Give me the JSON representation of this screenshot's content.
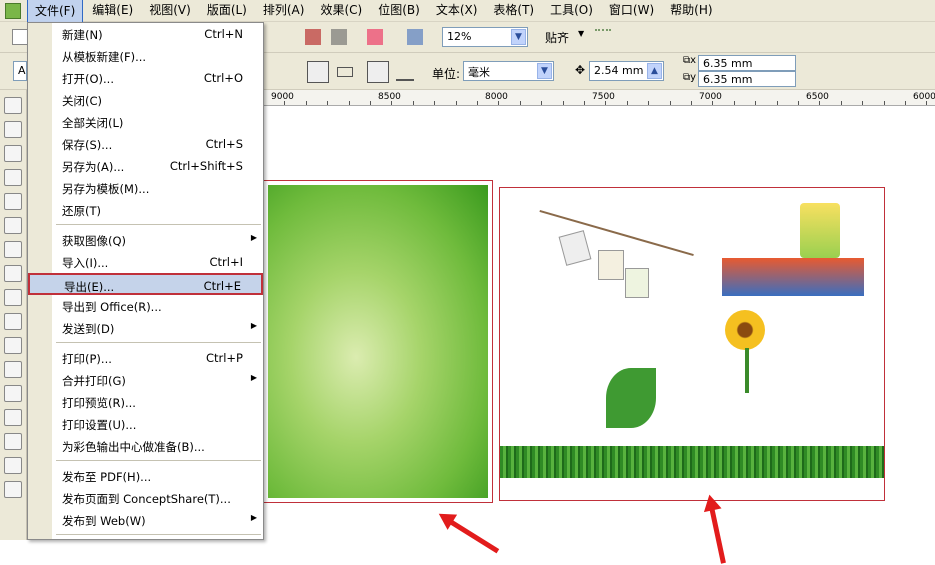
{
  "menubar": {
    "items": [
      "文件(F)",
      "编辑(E)",
      "视图(V)",
      "版面(L)",
      "排列(A)",
      "效果(C)",
      "位图(B)",
      "文本(X)",
      "表格(T)",
      "工具(O)",
      "窗口(W)",
      "帮助(H)"
    ]
  },
  "toolbar": {
    "zoom": "12%",
    "snap_label": "贴齐",
    "unit_label": "单位:",
    "unit_value": "毫米",
    "nudge": "2.54 mm",
    "dup_x": "6.35 mm",
    "dup_y": "6.35 mm",
    "font_partial": "A"
  },
  "ruler": {
    "labels": [
      "9000",
      "8500",
      "8000",
      "7500",
      "7000",
      "6500",
      "6000"
    ]
  },
  "file_menu": {
    "items": [
      {
        "label": "新建(N)",
        "shortcut": "Ctrl+N"
      },
      {
        "label": "从模板新建(F)...",
        "shortcut": ""
      },
      {
        "label": "打开(O)...",
        "shortcut": "Ctrl+O"
      },
      {
        "label": "关闭(C)",
        "shortcut": ""
      },
      {
        "label": "全部关闭(L)",
        "shortcut": ""
      },
      {
        "label": "保存(S)...",
        "shortcut": "Ctrl+S"
      },
      {
        "label": "另存为(A)...",
        "shortcut": "Ctrl+Shift+S"
      },
      {
        "label": "另存为模板(M)...",
        "shortcut": ""
      },
      {
        "label": "还原(T)",
        "shortcut": ""
      },
      {
        "label": "获取图像(Q)",
        "shortcut": "",
        "submenu": true
      },
      {
        "label": "导入(I)...",
        "shortcut": "Ctrl+I"
      },
      {
        "label": "导出(E)...",
        "shortcut": "Ctrl+E",
        "highlighted": true
      },
      {
        "label": "导出到 Office(R)...",
        "shortcut": ""
      },
      {
        "label": "发送到(D)",
        "shortcut": "",
        "submenu": true
      },
      {
        "label": "打印(P)...",
        "shortcut": "Ctrl+P"
      },
      {
        "label": "合并打印(G)",
        "shortcut": "",
        "submenu": true
      },
      {
        "label": "打印预览(R)...",
        "shortcut": ""
      },
      {
        "label": "打印设置(U)...",
        "shortcut": ""
      },
      {
        "label": "为彩色输出中心做准备(B)...",
        "shortcut": ""
      },
      {
        "label": "发布至 PDF(H)...",
        "shortcut": ""
      },
      {
        "label": "发布页面到 ConceptShare(T)...",
        "shortcut": ""
      },
      {
        "label": "发布到 Web(W)",
        "shortcut": "",
        "submenu": true
      }
    ]
  },
  "colors": {
    "highlight_border": "#c0303a",
    "arrow": "#e21c1c",
    "menu_highlight": "#c5d3ea"
  }
}
